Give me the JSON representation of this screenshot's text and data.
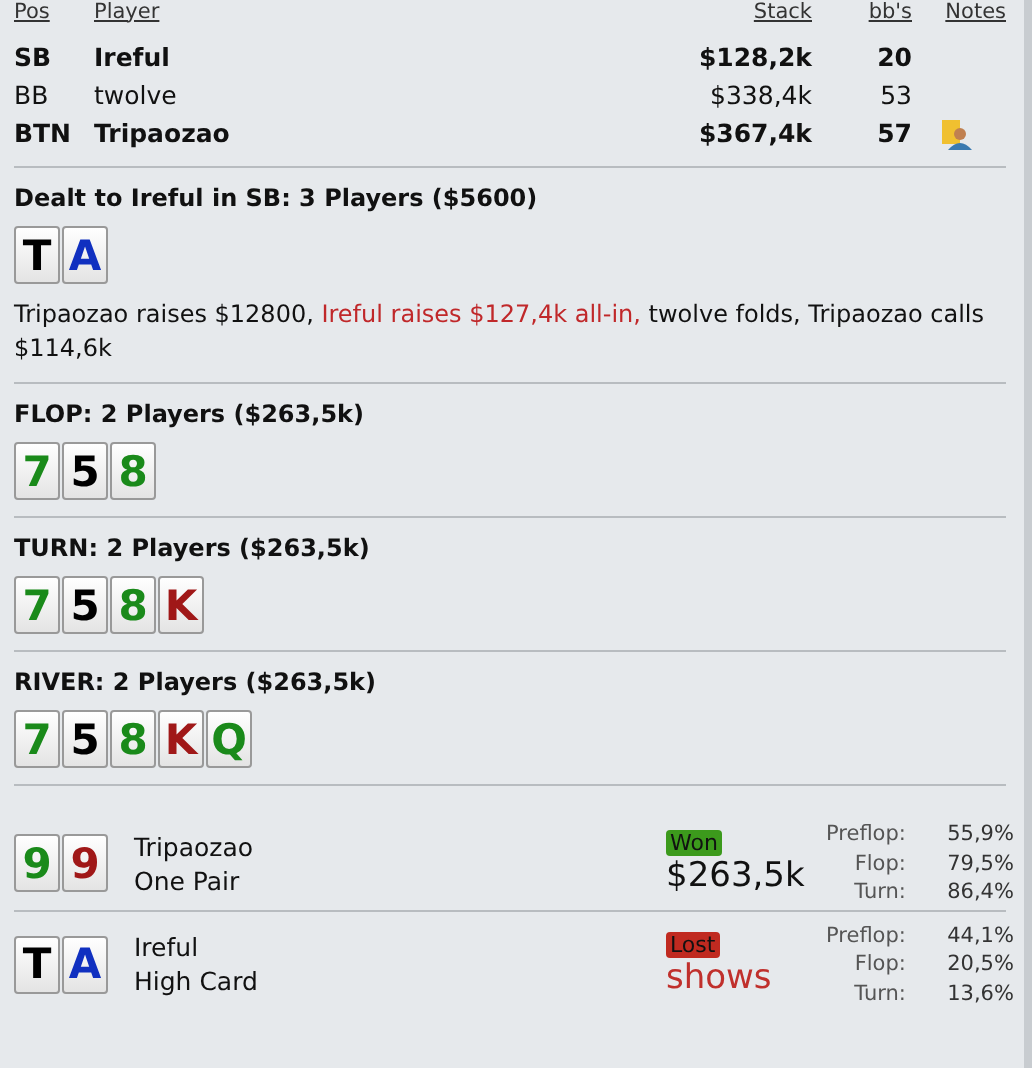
{
  "columns": {
    "pos": "Pos",
    "player": "Player",
    "stack": "Stack",
    "bbs": "bb's",
    "notes": "Notes"
  },
  "players": [
    {
      "pos": "SB",
      "name": "Ireful",
      "stack": "$128,2k",
      "bbs": "20",
      "highlighted": true,
      "has_note": false
    },
    {
      "pos": "BB",
      "name": "twolve",
      "stack": "$338,4k",
      "bbs": "53",
      "highlighted": false,
      "has_note": false
    },
    {
      "pos": "BTN",
      "name": "Tripaozao",
      "stack": "$367,4k",
      "bbs": "57",
      "highlighted": true,
      "has_note": true
    }
  ],
  "streets": [
    {
      "title": "Dealt to Ireful in SB: 3 Players ($5600)",
      "cards": [
        {
          "rank": "T",
          "color": "#000000"
        },
        {
          "rank": "A",
          "color": "#1030c0"
        }
      ],
      "actions": [
        {
          "text": "Tripaozao raises $12800, ",
          "kind": "normal"
        },
        {
          "text": "Ireful raises $127,4k all-in,",
          "kind": "allin"
        },
        {
          "text": " twolve folds, Tripaozao calls $114,6k",
          "kind": "normal"
        }
      ]
    },
    {
      "title": "FLOP: 2 Players ($263,5k)",
      "cards": [
        {
          "rank": "7",
          "color": "#1a8a1a"
        },
        {
          "rank": "5",
          "color": "#000000"
        },
        {
          "rank": "8",
          "color": "#1a8a1a"
        }
      ]
    },
    {
      "title": "TURN: 2 Players ($263,5k)",
      "cards": [
        {
          "rank": "7",
          "color": "#1a8a1a"
        },
        {
          "rank": "5",
          "color": "#000000"
        },
        {
          "rank": "8",
          "color": "#1a8a1a"
        },
        {
          "rank": "K",
          "color": "#a01818"
        }
      ]
    },
    {
      "title": "RIVER: 2 Players ($263,5k)",
      "cards": [
        {
          "rank": "7",
          "color": "#1a8a1a"
        },
        {
          "rank": "5",
          "color": "#000000"
        },
        {
          "rank": "8",
          "color": "#1a8a1a"
        },
        {
          "rank": "K",
          "color": "#a01818"
        },
        {
          "rank": "Q",
          "color": "#1a8a1a"
        }
      ]
    }
  ],
  "showdown": [
    {
      "cards": [
        {
          "rank": "9",
          "color": "#1a8a1a"
        },
        {
          "rank": "9",
          "color": "#a01818"
        }
      ],
      "name": "Tripaozao",
      "hand": "One Pair",
      "kind": "won",
      "badge": "Won",
      "amount": "$263,5k",
      "equity": [
        {
          "label": "Preflop:",
          "value": "55,9%"
        },
        {
          "label": "Flop:",
          "value": "79,5%"
        },
        {
          "label": "Turn:",
          "value": "86,4%"
        }
      ]
    },
    {
      "cards": [
        {
          "rank": "T",
          "color": "#000000"
        },
        {
          "rank": "A",
          "color": "#1030c0"
        }
      ],
      "name": "Ireful",
      "hand": "High Card",
      "kind": "lost",
      "badge": "Lost",
      "amount": "shows",
      "equity": [
        {
          "label": "Preflop:",
          "value": "44,1%"
        },
        {
          "label": "Flop:",
          "value": "20,5%"
        },
        {
          "label": "Turn:",
          "value": "13,6%"
        }
      ]
    }
  ]
}
